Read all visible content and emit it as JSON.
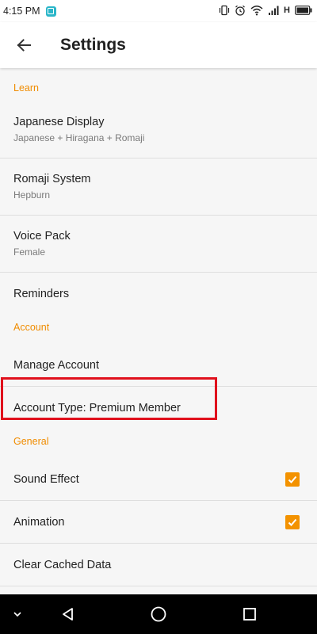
{
  "status_bar": {
    "time": "4:15 PM",
    "network": "H",
    "icons": [
      "app-notification-icon",
      "vibrate-icon",
      "alarm-icon",
      "wifi-icon",
      "signal-icon",
      "battery-icon"
    ]
  },
  "header": {
    "title": "Settings",
    "back_icon": "arrow-left-icon"
  },
  "sections": {
    "learn": {
      "label": "Learn",
      "items": [
        {
          "title": "Japanese Display",
          "subtitle": "Japanese + Hiragana + Romaji"
        },
        {
          "title": "Romaji System",
          "subtitle": "Hepburn"
        },
        {
          "title": "Voice Pack",
          "subtitle": "Female"
        },
        {
          "title": "Reminders"
        }
      ]
    },
    "account": {
      "label": "Account",
      "items": [
        {
          "title": "Manage Account"
        },
        {
          "title": "Account Type: Premium Member"
        }
      ]
    },
    "general": {
      "label": "General",
      "items": [
        {
          "title": "Sound Effect",
          "checked": true
        },
        {
          "title": "Animation",
          "checked": true
        },
        {
          "title": "Clear Cached Data"
        }
      ]
    }
  },
  "colors": {
    "accent": "#f39200",
    "section_header": "#f08c00",
    "highlight": "#e0101c"
  },
  "nav_bar": {
    "icons": [
      "chevron-down-icon",
      "back-triangle-icon",
      "home-circle-icon",
      "recents-square-icon"
    ]
  }
}
